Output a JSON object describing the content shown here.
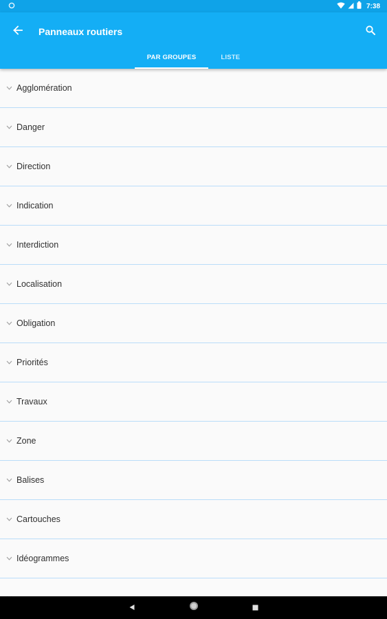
{
  "status_bar": {
    "time": "7:38",
    "icons": [
      "notification-dot-icon",
      "wifi-icon",
      "cell-signal-icon",
      "battery-icon"
    ]
  },
  "app_bar": {
    "back_icon": "arrow-back-icon",
    "title": "Panneaux routiers",
    "search_icon": "search-icon",
    "tabs": [
      {
        "label": "PAR GROUPES",
        "active": true
      },
      {
        "label": "LISTE",
        "active": false
      }
    ]
  },
  "groups": [
    "Agglomération",
    "Danger",
    "Direction",
    "Indication",
    "Interdiction",
    "Localisation",
    "Obligation",
    "Priorités",
    "Travaux",
    "Zone",
    "Balises",
    "Cartouches",
    "Idéogrammes"
  ],
  "nav_bar": {
    "buttons": [
      "back-triangle-icon",
      "home-circle-icon",
      "recents-square-icon"
    ]
  },
  "colors": {
    "status_bar": "#0fa3e8",
    "app_bar": "#14aef5",
    "divider": "#b9dcf9",
    "list_bg": "#fafafa"
  }
}
